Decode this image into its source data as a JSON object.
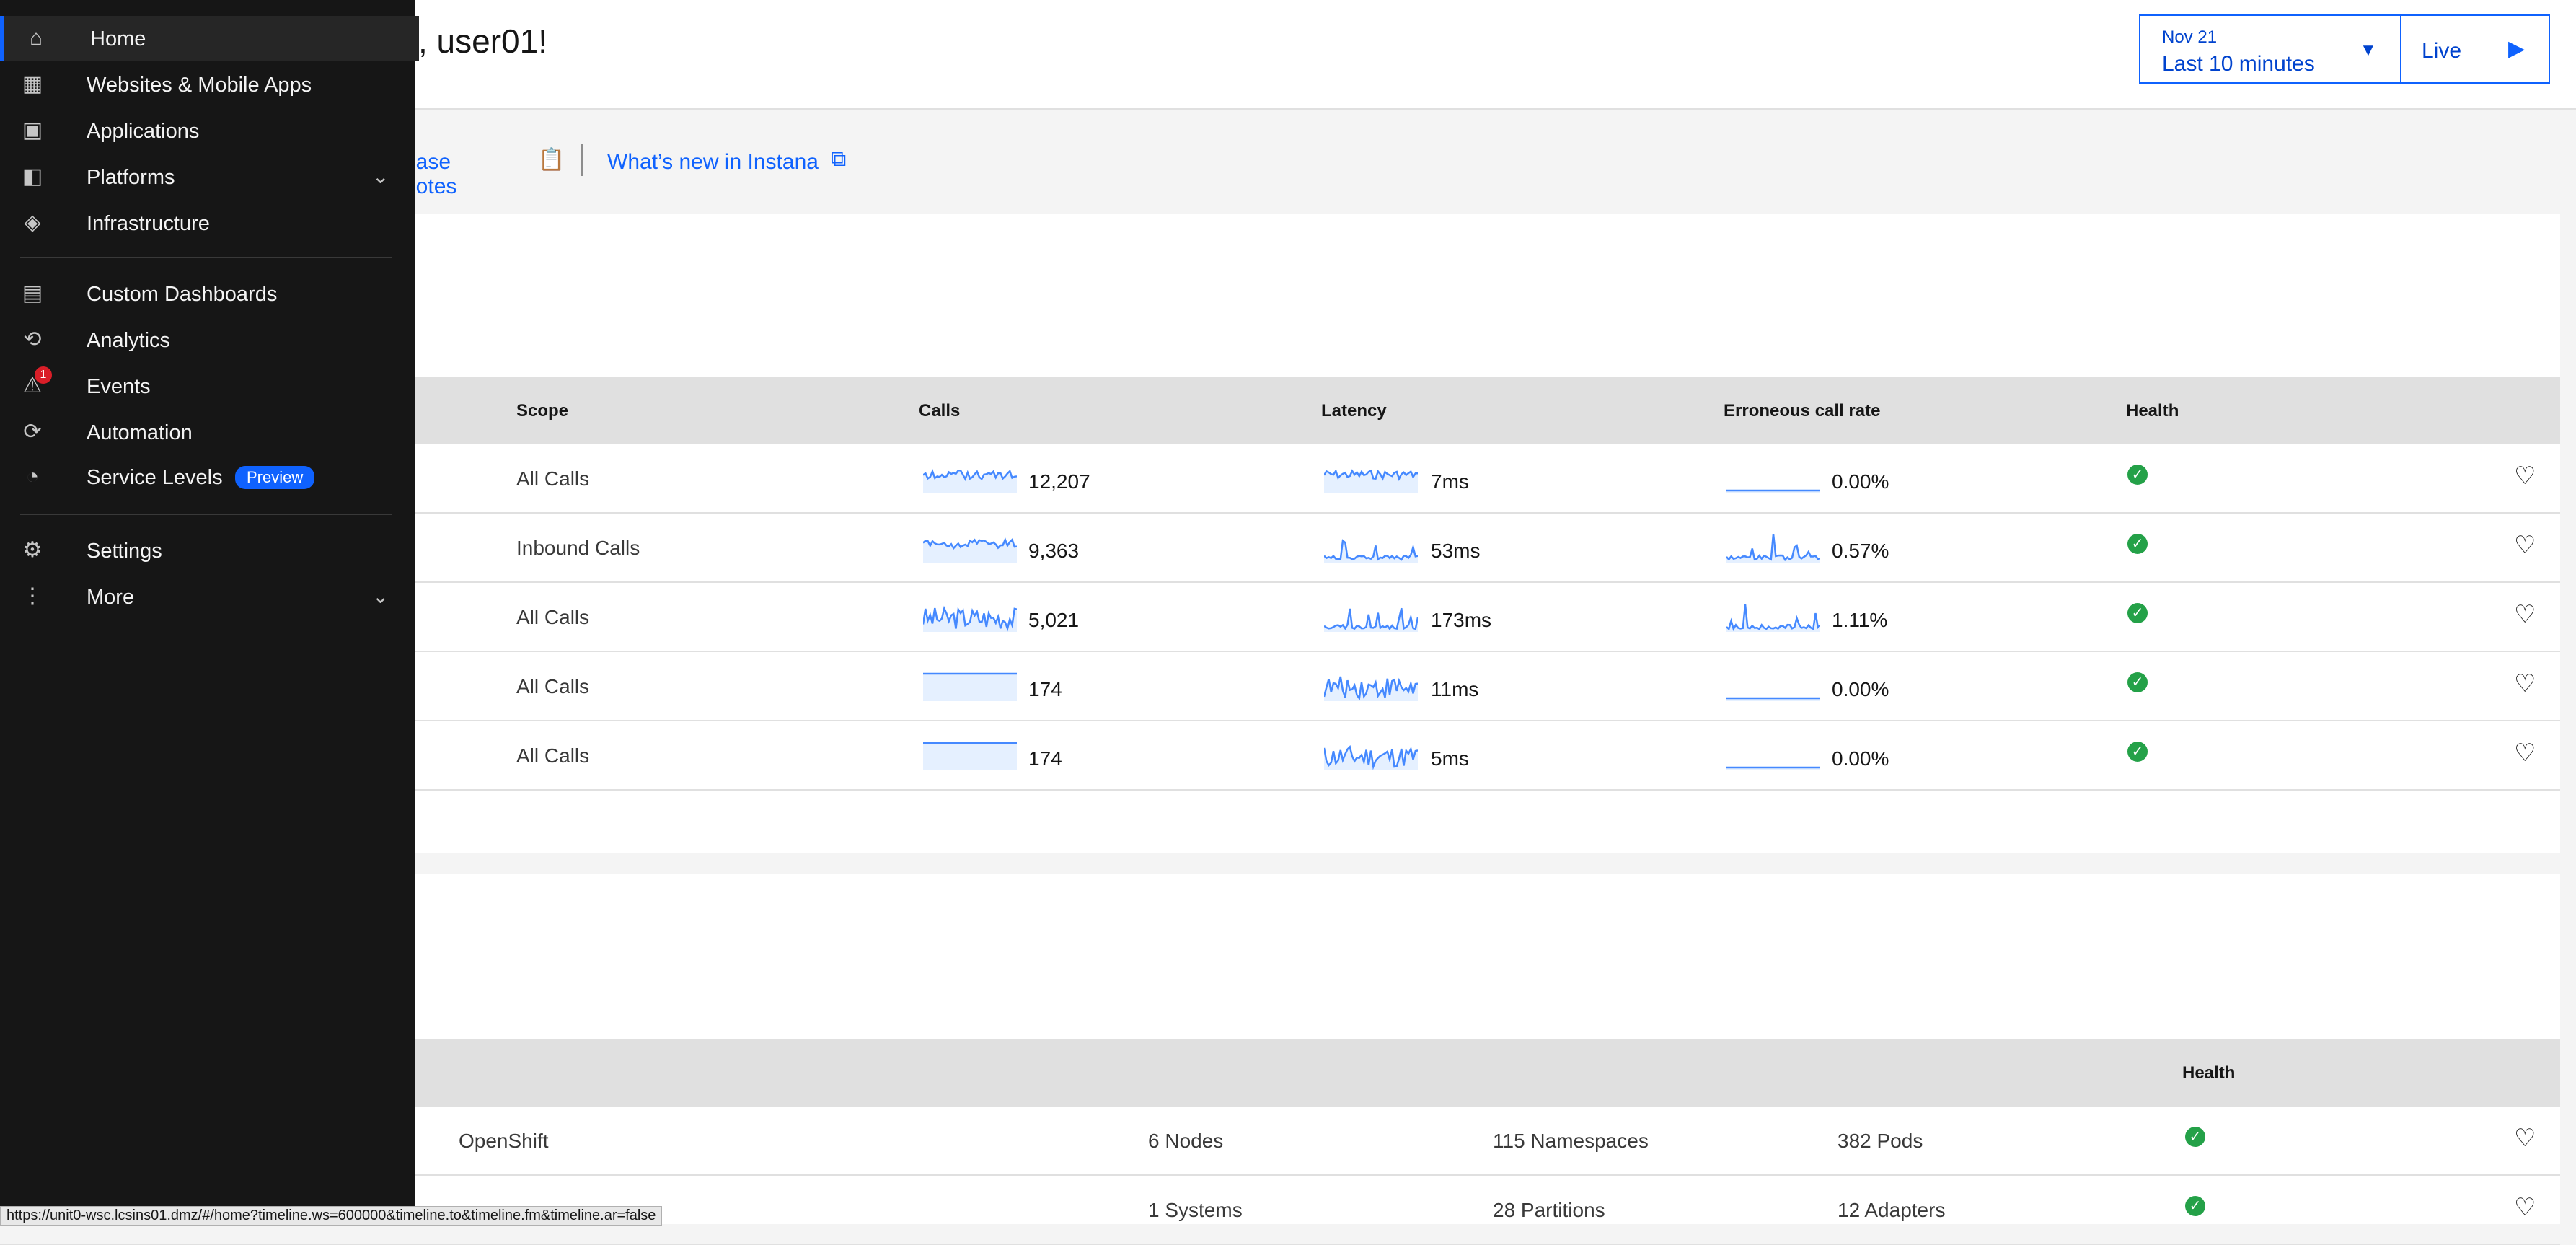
{
  "header": {
    "greeting": ", user01!",
    "time_picker": {
      "date": "Nov 21",
      "range_label": "Last 10 minutes",
      "live_label": "Live"
    }
  },
  "links": {
    "release_notes": "ease notes",
    "whats_new": "What’s new in Instana"
  },
  "apps_table": {
    "headers": {
      "scope": "Scope",
      "calls": "Calls",
      "latency": "Latency",
      "error_rate": "Erroneous call rate",
      "health": "Health"
    },
    "rows": [
      {
        "scope": "All Calls",
        "calls": "12,207",
        "latency": "7ms",
        "error_rate": "0.00%"
      },
      {
        "scope": "Inbound Calls",
        "calls": "9,363",
        "latency": "53ms",
        "error_rate": "0.57%"
      },
      {
        "scope": "All Calls",
        "calls": "5,021",
        "latency": "173ms",
        "error_rate": "1.11%"
      },
      {
        "scope": "All Calls",
        "calls": "174",
        "latency": "11ms",
        "error_rate": "0.00%"
      },
      {
        "scope": "All Calls",
        "calls": "174",
        "latency": "5ms",
        "error_rate": "0.00%"
      }
    ]
  },
  "infra_table": {
    "headers": {
      "health": "Health"
    },
    "rows": [
      {
        "type": "OpenShift",
        "c1": "6 Nodes",
        "c2": "115 Namespaces",
        "c3": "382 Pods"
      },
      {
        "type": "",
        "c1": "1 Systems",
        "c2": "28 Partitions",
        "c3": "12 Adapters"
      }
    ]
  },
  "sidebar": {
    "items": [
      {
        "label": "Home",
        "icon": "home-icon"
      },
      {
        "label": "Websites & Mobile Apps",
        "icon": "websites-icon"
      },
      {
        "label": "Applications",
        "icon": "applications-icon"
      },
      {
        "label": "Platforms",
        "icon": "platforms-icon"
      },
      {
        "label": "Infrastructure",
        "icon": "infrastructure-icon"
      },
      {
        "label": "Custom Dashboards",
        "icon": "dashboard-icon"
      },
      {
        "label": "Analytics",
        "icon": "analytics-icon"
      },
      {
        "label": "Events",
        "icon": "events-icon",
        "badge": "1"
      },
      {
        "label": "Automation",
        "icon": "automation-icon"
      },
      {
        "label": "Service Levels",
        "icon": "service-levels-icon",
        "badge_label": "Preview"
      },
      {
        "label": "Settings",
        "icon": "settings-icon"
      },
      {
        "label": "More",
        "icon": "more-icon"
      }
    ]
  },
  "status_bar": {
    "url": "https://unit0-wsc.lcsins01.dmz/#/home?timeline.ws=600000&timeline.to&timeline.fm&timeline.ar=false"
  },
  "colors": {
    "accent": "#0f62fe",
    "sidebar_bg": "#161616",
    "health_ok": "#24a148",
    "spark": "#4589ff"
  }
}
